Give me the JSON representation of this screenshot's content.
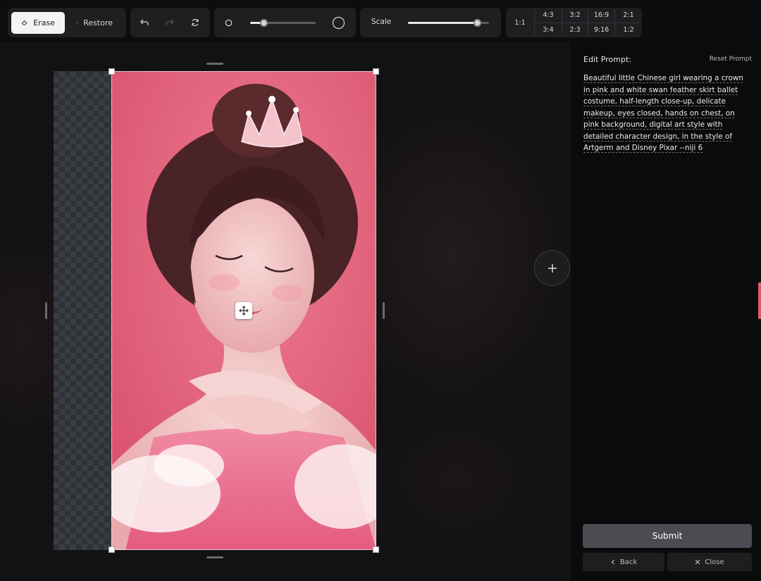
{
  "toolbar": {
    "erase_label": "Erase",
    "restore_label": "Restore",
    "brush_size_fraction": 0.2,
    "scale_label": "Scale",
    "scale_fraction": 0.85,
    "ratios_top": [
      "4:3",
      "3:2",
      "16:9",
      "2:1"
    ],
    "ratios_bottom": [
      "3:4",
      "2:3",
      "9:16",
      "1:2"
    ],
    "ratio_square": "1:1"
  },
  "panel": {
    "prompt_label": "Edit Prompt:",
    "reset_label": "Reset Prompt",
    "prompt_text": "Beautiful little Chinese girl wearing a crown in pink and white swan feather skirt ballet costume, half-length close-up, delicate makeup, eyes closed, hands on chest, on pink background, digital art style with detailed character design, in the style of Artgerm and Disney Pixar --niji 6",
    "submit_label": "Submit",
    "back_label": "Back",
    "close_label": "Close"
  },
  "colors": {
    "accent_pink": "#e05f78",
    "panel_bg": "#0b0b0c",
    "button_active_bg": "#f4f4f5",
    "submit_bg": "#4b4b52"
  }
}
